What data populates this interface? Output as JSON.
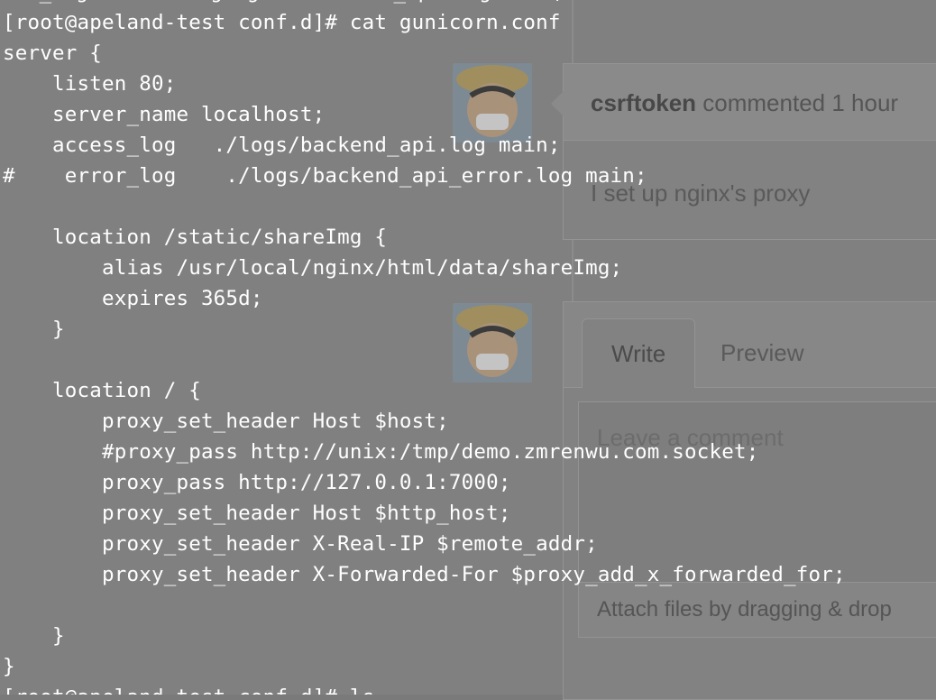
{
  "background_ui": {
    "comment_author": "csrftoken",
    "comment_meta": " commented 1 hour",
    "comment_body": "I set up nginx's proxy",
    "tab_write": "Write",
    "tab_preview": "Preview",
    "comment_placeholder": "Leave a comment",
    "attach_hint": "Attach files by dragging & drop"
  },
  "terminal": {
    "top_partial": "ess_log   /var/log/nginx/backend_api.log main;",
    "lines": [
      "[root@apeland-test conf.d]# cat gunicorn.conf",
      "server {",
      "    listen 80;",
      "    server_name localhost;",
      "    access_log   ./logs/backend_api.log main;",
      "#    error_log    ./logs/backend_api_error.log main;",
      "",
      "    location /static/shareImg {",
      "        alias /usr/local/nginx/html/data/shareImg;",
      "        expires 365d;",
      "    }",
      "",
      "    location / {",
      "        proxy_set_header Host $host;",
      "        #proxy_pass http://unix:/tmp/demo.zmrenwu.com.socket;",
      "        proxy_pass http://127.0.0.1:7000;",
      "        proxy_set_header Host $http_host;",
      "        proxy_set_header X-Real-IP $remote_addr;",
      "        proxy_set_header X-Forwarded-For $proxy_add_x_forwarded_for;",
      "",
      "    }",
      "}",
      "[root@apeland-test conf.d]# ls"
    ]
  }
}
